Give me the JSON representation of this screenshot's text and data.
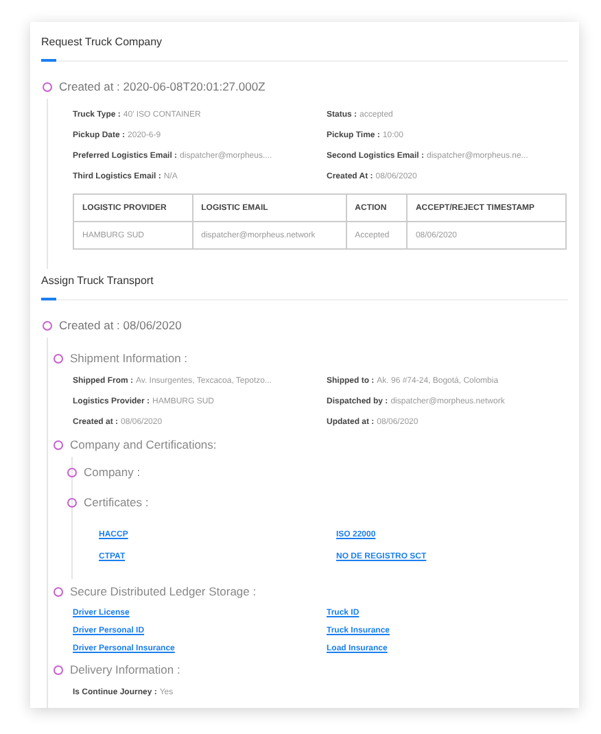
{
  "sections": [
    {
      "title": "Request Truck Company",
      "created": "Created at : 2020-06-08T20:01:27.000Z",
      "fields": [
        {
          "label": "Truck Type :",
          "value": "40' ISO CONTAINER"
        },
        {
          "label": "Status :",
          "value": "accepted"
        },
        {
          "label": "Pickup Date :",
          "value": "2020-6-9"
        },
        {
          "label": "Pickup Time :",
          "value": "10:00"
        },
        {
          "label": "Preferred Logistics Email :",
          "value": "dispatcher@morpheus...."
        },
        {
          "label": "Second Logistics Email :",
          "value": "dispatcher@morpheus.ne..."
        },
        {
          "label": "Third Logistics Email :",
          "value": "N/A"
        },
        {
          "label": "Created At :",
          "value": "08/06/2020"
        }
      ],
      "table": {
        "columns": [
          "LOGISTIC PROVIDER",
          "LOGISTIC EMAIL",
          "ACTION",
          "ACCEPT/REJECT TIMESTAMP"
        ],
        "rows": [
          [
            "HAMBURG SUD",
            "dispatcher@morpheus.network",
            "Accepted",
            "08/06/2020"
          ]
        ]
      }
    },
    {
      "title": "Assign Truck Transport",
      "created": "Created at : 08/06/2020",
      "groups": [
        {
          "kind": "fields",
          "title": "Shipment Information :",
          "fields": [
            {
              "label": "Shipped From :",
              "value": "Av. Insurgentes, Texcacoa, Tepotzo..."
            },
            {
              "label": "Shipped to :",
              "value": "Ak. 96 #74-24, Bogotá, Colombia"
            },
            {
              "label": "Logistics Provider :",
              "value": "HAMBURG SUD"
            },
            {
              "label": "Dispatched by :",
              "value": "dispatcher@morpheus.network"
            },
            {
              "label": "Created at :",
              "value": "08/06/2020"
            },
            {
              "label": "Updated at :",
              "value": "08/06/2020"
            }
          ]
        },
        {
          "kind": "nested",
          "title": "Company and Certifications:",
          "children": [
            {
              "title": "Company :"
            },
            {
              "title": "Certificates :",
              "links": [
                "HACCP",
                "ISO 22000",
                "CTPAT",
                "NO DE REGISTRO SCT"
              ]
            }
          ]
        },
        {
          "kind": "links",
          "title": "Secure Distributed Ledger Storage :",
          "links": [
            "Driver License",
            "Truck ID",
            "Driver Personal ID",
            "Truck Insurance",
            "Driver Personal Insurance",
            "Load Insurance"
          ]
        },
        {
          "kind": "fields",
          "title": "Delivery Information :",
          "fields": [
            {
              "label": "Is Continue Journey :",
              "value": "Yes"
            }
          ]
        }
      ]
    }
  ]
}
